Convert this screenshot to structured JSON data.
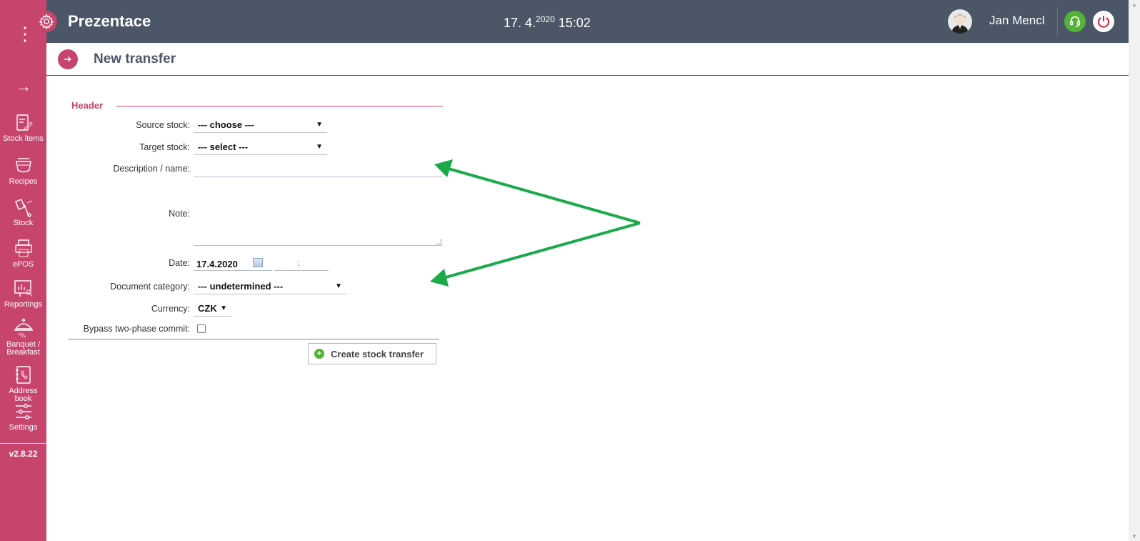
{
  "topbar": {
    "app_title": "Prezentace",
    "date_day": "17. 4.",
    "date_year": "2020",
    "time": "15:02",
    "user_name": "Jan Mencl"
  },
  "sidebar": {
    "items": [
      {
        "label": "Stock items",
        "icon": "stock-items-icon"
      },
      {
        "label": "Recipes",
        "icon": "recipes-icon"
      },
      {
        "label": "Stock",
        "icon": "stock-icon"
      },
      {
        "label": "ePOS",
        "icon": "printer-icon"
      },
      {
        "label": "Reportings",
        "icon": "reportings-icon"
      },
      {
        "label": "Banquet / Breakfast",
        "icon": "cloche-icon"
      },
      {
        "label": "Address book",
        "icon": "address-book-icon"
      },
      {
        "label": "Settings",
        "icon": "sliders-icon"
      }
    ],
    "version": "v2.8.22"
  },
  "page": {
    "title": "New transfer"
  },
  "form": {
    "section_title": "Header",
    "source_stock_label": "Source stock:",
    "source_stock_value": "--- choose ---",
    "target_stock_label": "Target stock:",
    "target_stock_value": "--- select ---",
    "description_label": "Description / name:",
    "note_label": "Note:",
    "date_label": "Date:",
    "date_value": "17.4.2020",
    "time_separator": ":",
    "document_category_label": "Document category:",
    "document_category_value": "--- undetermined ---",
    "currency_label": "Currency:",
    "currency_value": "CZK",
    "bypass_label": "Bypass two-phase commit:",
    "bypass_checked": false,
    "submit_label": "Create stock transfer"
  },
  "colors": {
    "sidebar": "#c7446d",
    "topbar": "#4b5767",
    "accent": "#c7446d",
    "annotation_arrow": "#1aaa4a",
    "support": "#53b336"
  }
}
